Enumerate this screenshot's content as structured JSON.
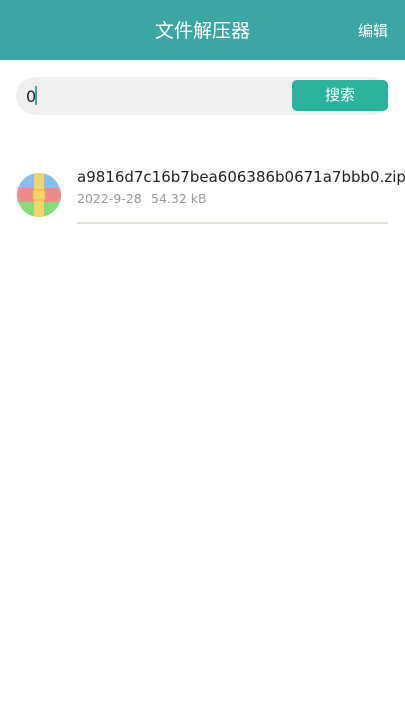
{
  "header": {
    "title": "文件解压器",
    "edit_label": "编辑"
  },
  "search": {
    "value": "0",
    "button_label": "搜索"
  },
  "files": [
    {
      "name": "a9816d7c16b7bea606386b0671a7bbb0.zip",
      "date": "2022-9-28",
      "size": "54.32 kB",
      "icon": "zip-archive-icon"
    }
  ],
  "colors": {
    "header_bg": "#3aa7a5",
    "search_button_bg": "#2bb39b",
    "search_bar_bg": "#efefef",
    "divider": "#e3e0cd"
  }
}
